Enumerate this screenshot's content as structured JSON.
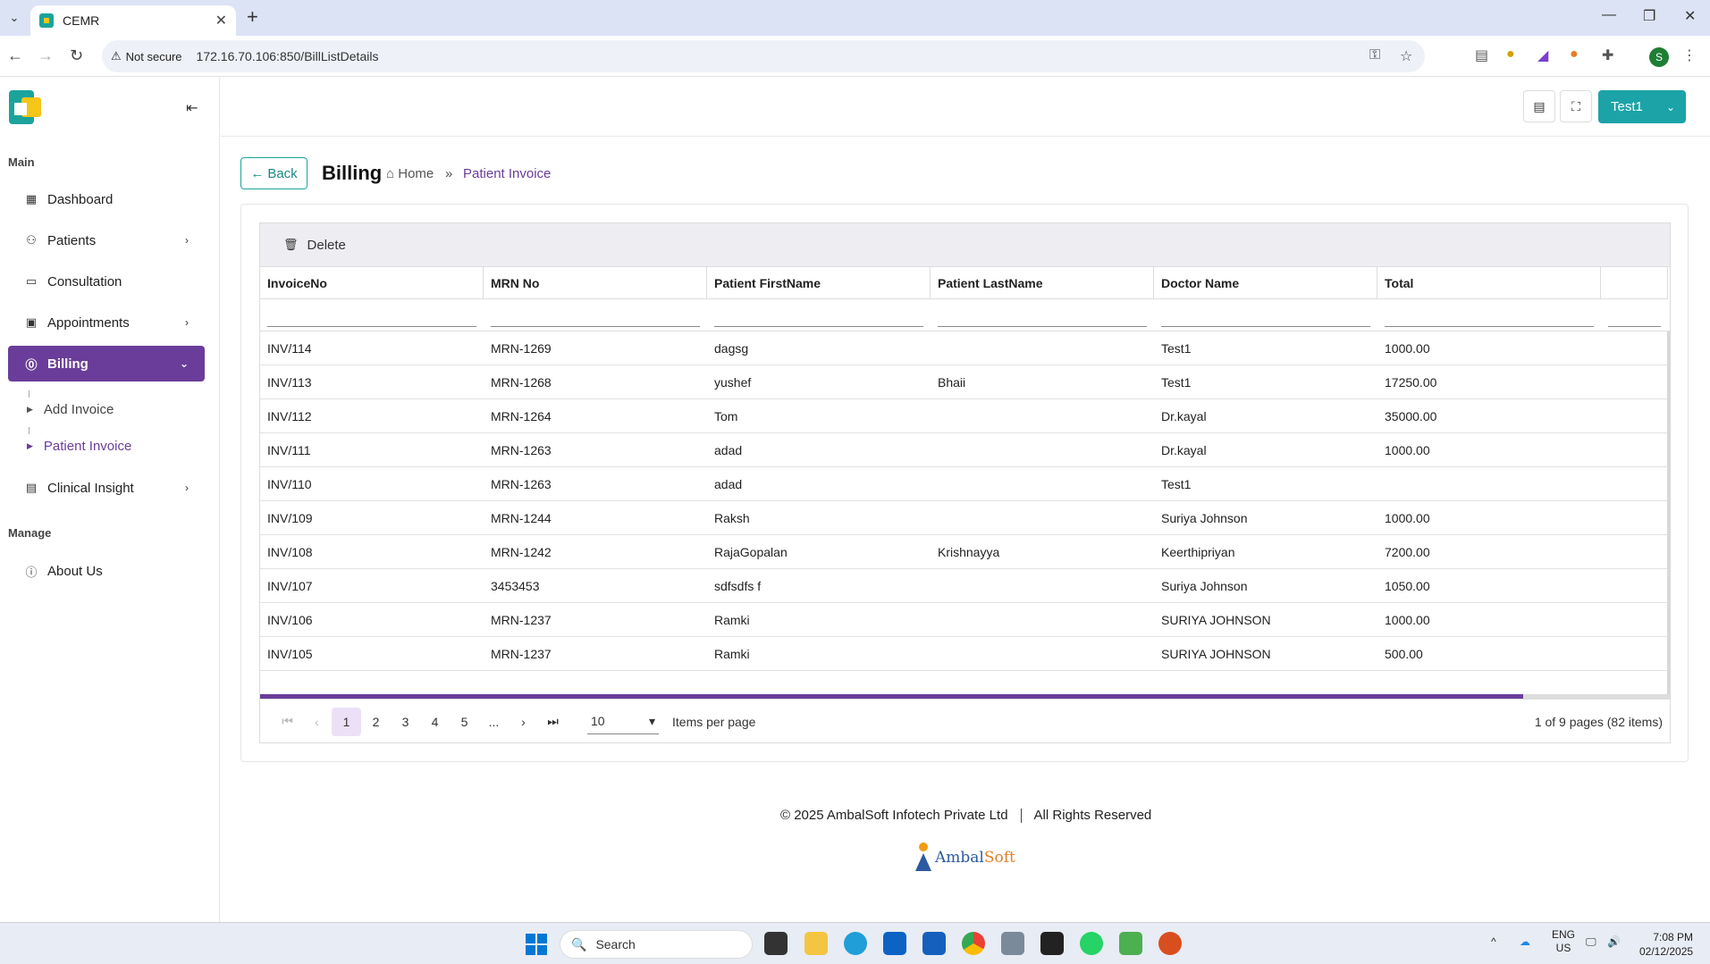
{
  "browser": {
    "tab_title": "CEMR",
    "not_secure": "Not secure",
    "url": "172.16.70.106:850/BillListDetails",
    "profile_initial": "S"
  },
  "sidebar": {
    "section_main": "Main",
    "section_manage": "Manage",
    "items": [
      {
        "label": "Dashboard",
        "icon": "dashboard-icon"
      },
      {
        "label": "Patients",
        "icon": "users-icon"
      },
      {
        "label": "Consultation",
        "icon": "consultation-icon"
      },
      {
        "label": "Appointments",
        "icon": "calendar-icon"
      },
      {
        "label": "Billing",
        "icon": "billing-icon"
      },
      {
        "label": "Clinical Insight",
        "icon": "clipboard-icon"
      }
    ],
    "billing_sub": [
      {
        "label": "Add Invoice"
      },
      {
        "label": "Patient Invoice"
      }
    ],
    "manage_items": [
      {
        "label": "About Us",
        "icon": "info-icon"
      }
    ]
  },
  "topbar": {
    "user": "Test1"
  },
  "page": {
    "back": "Back",
    "title": "Billing",
    "breadcrumb_home": "Home",
    "breadcrumb_current": "Patient Invoice"
  },
  "grid": {
    "toolbar_delete": "Delete",
    "columns": [
      "InvoiceNo",
      "MRN No",
      "Patient FirstName",
      "Patient LastName",
      "Doctor Name",
      "Total"
    ],
    "rows": [
      [
        "INV/114",
        "MRN-1269",
        "dagsg",
        "",
        "Test1",
        "1000.00"
      ],
      [
        "INV/113",
        "MRN-1268",
        "yushef",
        "Bhaii",
        "Test1",
        "17250.00"
      ],
      [
        "INV/112",
        "MRN-1264",
        "Tom",
        "",
        "Dr.kayal",
        "35000.00"
      ],
      [
        "INV/111",
        "MRN-1263",
        "adad",
        "",
        "Dr.kayal",
        "1000.00"
      ],
      [
        "INV/110",
        "MRN-1263",
        "adad",
        "",
        "Test1",
        ""
      ],
      [
        "INV/109",
        "MRN-1244",
        "Raksh",
        "",
        "Suriya Johnson",
        "1000.00"
      ],
      [
        "INV/108",
        "MRN-1242",
        "RajaGopalan",
        "Krishnayya",
        "Keerthipriyan",
        "7200.00"
      ],
      [
        "INV/107",
        "3453453",
        "sdfsdfs f",
        "",
        "Suriya Johnson",
        "1050.00"
      ],
      [
        "INV/106",
        "MRN-1237",
        "Ramki",
        "",
        "SURIYA JOHNSON",
        "1000.00"
      ],
      [
        "INV/105",
        "MRN-1237",
        "Ramki",
        "",
        "SURIYA JOHNSON",
        "500.00"
      ]
    ],
    "pager": {
      "pages": [
        "1",
        "2",
        "3",
        "4",
        "5",
        "..."
      ],
      "current": "1",
      "page_size": "10",
      "items_per_page": "Items per page",
      "info": "1 of 9 pages (82 items)"
    }
  },
  "footer": {
    "copyright": "© 2025 AmbalSoft Infotech Private Ltd",
    "rights": "All Rights Reserved",
    "logo_text_a": "Ambal",
    "logo_text_b": "Soft"
  },
  "taskbar": {
    "search": "Search",
    "lang": "ENG",
    "region": "US",
    "time": "7:08 PM",
    "date": "02/12/2025"
  }
}
